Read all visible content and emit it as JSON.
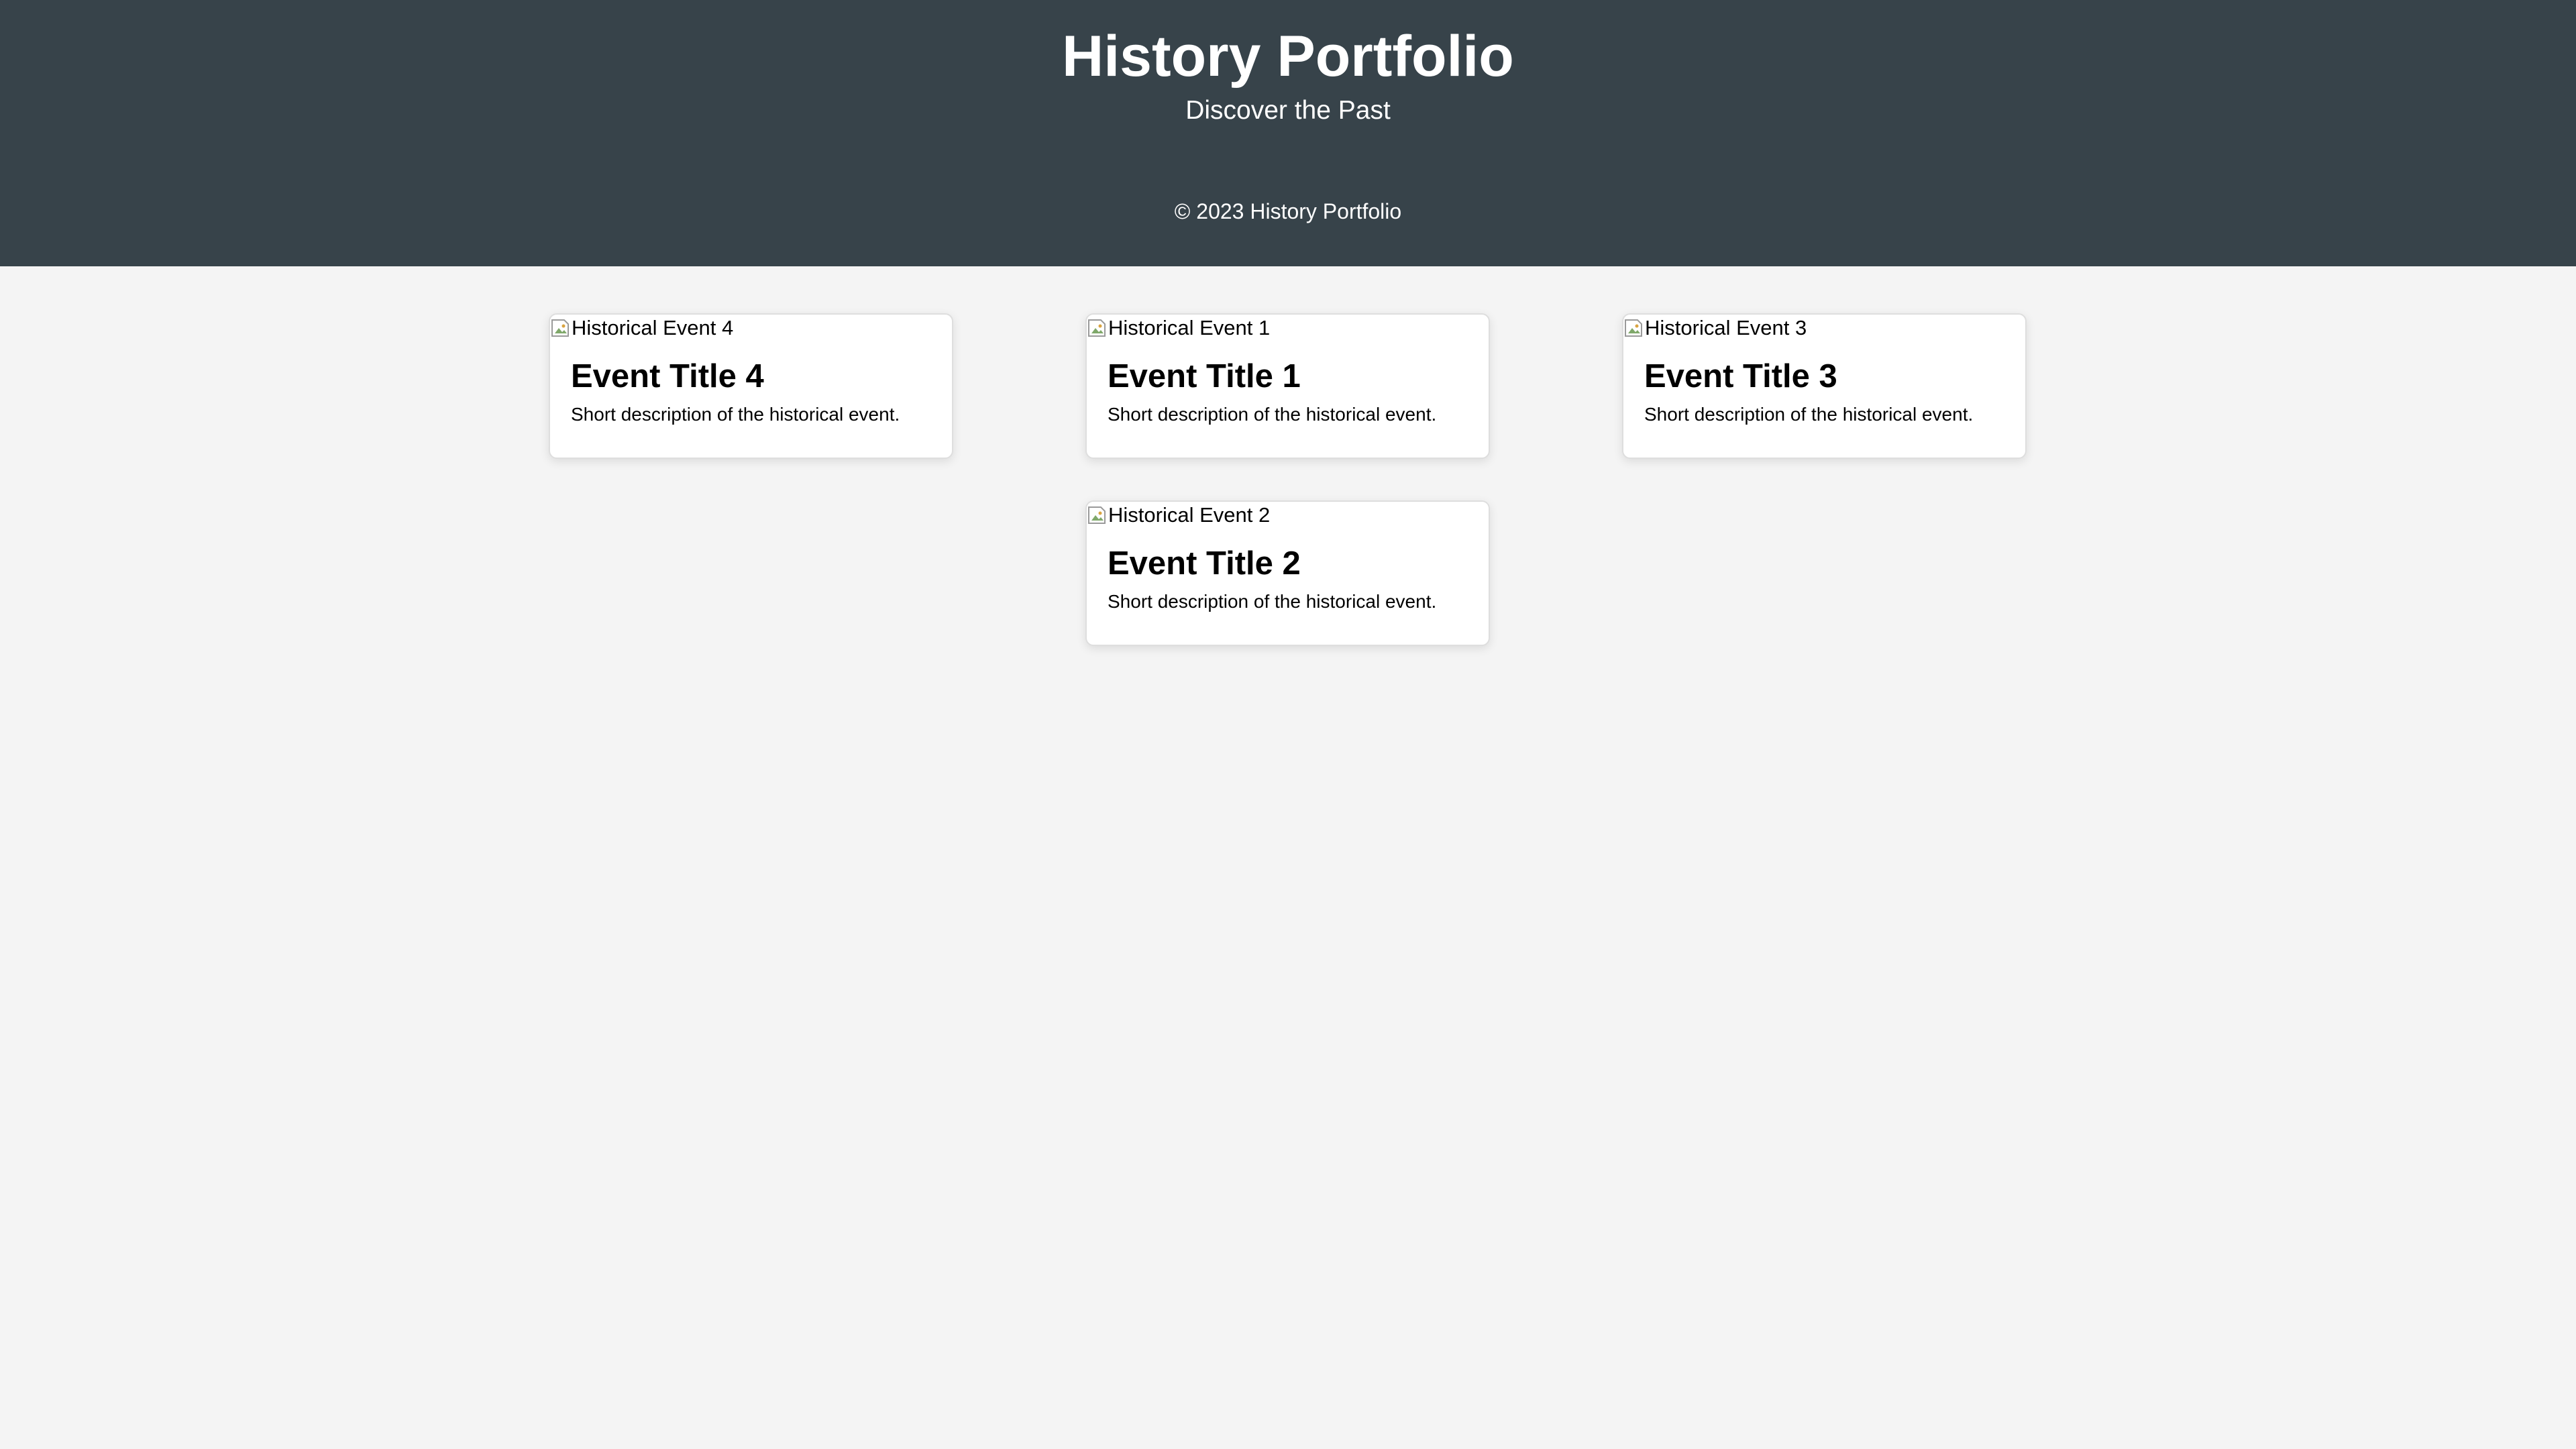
{
  "header": {
    "title": "History Portfolio",
    "tagline": "Discover the Past",
    "copyright": "© 2023 History Portfolio"
  },
  "cards": [
    {
      "image_alt": "Historical Event 4",
      "title": "Event Title 4",
      "description": "Short description of the historical event."
    },
    {
      "image_alt": "Historical Event 1",
      "title": "Event Title 1",
      "description": "Short description of the historical event."
    },
    {
      "image_alt": "Historical Event 3",
      "title": "Event Title 3",
      "description": "Short description of the historical event."
    },
    {
      "image_alt": "Historical Event 2",
      "title": "Event Title 2",
      "description": "Short description of the historical event."
    }
  ],
  "colors": {
    "header_background": "#37434a",
    "page_background": "#f4f4f4",
    "card_background": "#ffffff"
  },
  "icons": {
    "card_image": "broken-image-icon"
  }
}
